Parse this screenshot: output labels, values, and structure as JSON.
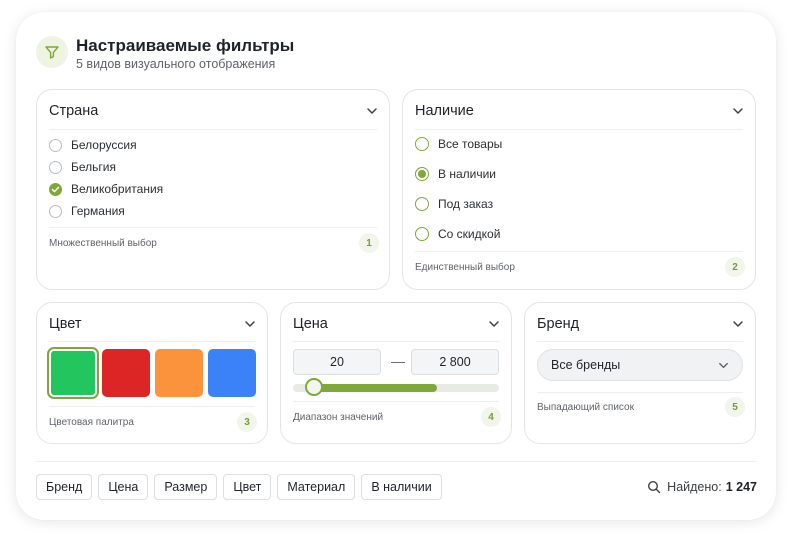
{
  "header": {
    "title": "Настраиваемые фильтры",
    "subtitle": "5 видов визуального отображения",
    "icon": "filter-icon"
  },
  "cards": {
    "country": {
      "title": "Страна",
      "options": [
        {
          "label": "Белоруссия",
          "checked": false
        },
        {
          "label": "Бельгия",
          "checked": false
        },
        {
          "label": "Великобритания",
          "checked": true
        },
        {
          "label": "Германия",
          "checked": false
        }
      ],
      "footer": "Множественный выбор",
      "badge": "1"
    },
    "availability": {
      "title": "Наличие",
      "options": [
        {
          "label": "Все товары",
          "selected": false
        },
        {
          "label": "В наличии",
          "selected": true
        },
        {
          "label": "Под заказ",
          "selected": false
        },
        {
          "label": "Со скидкой",
          "selected": false
        }
      ],
      "footer": "Единственный выбор",
      "badge": "2"
    },
    "color": {
      "title": "Цвет",
      "swatches": [
        {
          "name": "green",
          "hex": "#22c55e",
          "selected": true
        },
        {
          "name": "red",
          "hex": "#dc2626",
          "selected": false
        },
        {
          "name": "orange",
          "hex": "#fb923c",
          "selected": false
        },
        {
          "name": "blue",
          "hex": "#3b82f6",
          "selected": false
        }
      ],
      "footer": "Цветовая палитра",
      "badge": "3"
    },
    "price": {
      "title": "Цена",
      "min_value": "20",
      "max_value": "2 800",
      "separator": "—",
      "range_fraction": [
        0.1,
        0.7
      ],
      "footer": "Диапазон значений",
      "badge": "4"
    },
    "brand": {
      "title": "Бренд",
      "selected": "Все бренды",
      "footer": "Выпадающий список",
      "badge": "5"
    }
  },
  "chips": [
    "Бренд",
    "Цена",
    "Размер",
    "Цвет",
    "Материал",
    "В наличии"
  ],
  "results": {
    "label": "Найдено:",
    "count": "1 247"
  },
  "colors": {
    "accent": "#7ea83a",
    "accent_light": "#eef3e2"
  }
}
